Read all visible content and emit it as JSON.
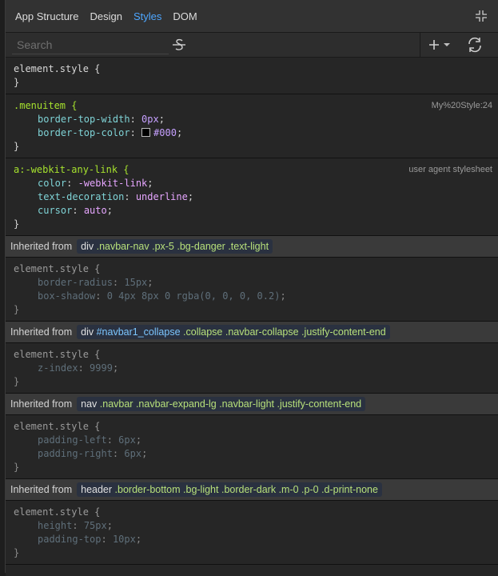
{
  "tabs": [
    "App Structure",
    "Design",
    "Styles",
    "DOM"
  ],
  "active_tab": "Styles",
  "search": {
    "placeholder": "Search"
  },
  "rules": [
    {
      "selector": "element.style {",
      "source": "",
      "decls": [],
      "close": "}"
    },
    {
      "selector": ".menuitem {",
      "source": "My%20Style:24",
      "decls": [
        {
          "prop": "border-top-width",
          "val": "0px"
        },
        {
          "prop": "border-top-color",
          "val": "#000"
        }
      ],
      "close": "}"
    },
    {
      "selector": "a:-webkit-any-link {",
      "source": "user agent stylesheet",
      "decls": [
        {
          "prop": "color",
          "val": "-webkit-link"
        },
        {
          "prop": "text-decoration",
          "val": "underline"
        },
        {
          "prop": "cursor",
          "val": "auto"
        }
      ],
      "close": "}"
    }
  ],
  "inherited": [
    {
      "label": "Inherited from",
      "tag": "div",
      "parts": [
        ".navbar-nav",
        ".px-5",
        ".bg-danger",
        ".text-light"
      ],
      "selector": "element.style {",
      "decls": [
        {
          "prop": "border-radius",
          "val": "15px"
        },
        {
          "prop": "box-shadow",
          "val": "0 4px 8px 0 rgba(0, 0, 0, 0.2)"
        }
      ],
      "close": "}"
    },
    {
      "label": "Inherited from",
      "tag": "div",
      "parts": [
        "#navbar1_collapse",
        ".collapse",
        ".navbar-collapse",
        ".justify-content-end"
      ],
      "selector": "element.style {",
      "decls": [
        {
          "prop": "z-index",
          "val": "9999"
        }
      ],
      "close": "}"
    },
    {
      "label": "Inherited from",
      "tag": "nav",
      "parts": [
        ".navbar",
        ".navbar-expand-lg",
        ".navbar-light",
        ".justify-content-end"
      ],
      "selector": "element.style {",
      "decls": [
        {
          "prop": "padding-left",
          "val": "6px"
        },
        {
          "prop": "padding-right",
          "val": "6px"
        }
      ],
      "close": "}"
    },
    {
      "label": "Inherited from",
      "tag": "header",
      "parts": [
        ".border-bottom",
        ".bg-light",
        ".border-dark",
        ".m-0",
        ".p-0",
        ".d-print-none"
      ],
      "selector": "element.style {",
      "decls": [
        {
          "prop": "height",
          "val": "75px"
        },
        {
          "prop": "padding-top",
          "val": "10px"
        }
      ],
      "close": "}"
    }
  ],
  "colors": {
    "accent": "#4da6ff",
    "panel": "#262626",
    "header": "#3a3a3a"
  },
  "icons": [
    "collapse-icon",
    "strikethrough-icon",
    "plus-icon",
    "chevron-down-icon",
    "refresh-icon"
  ]
}
